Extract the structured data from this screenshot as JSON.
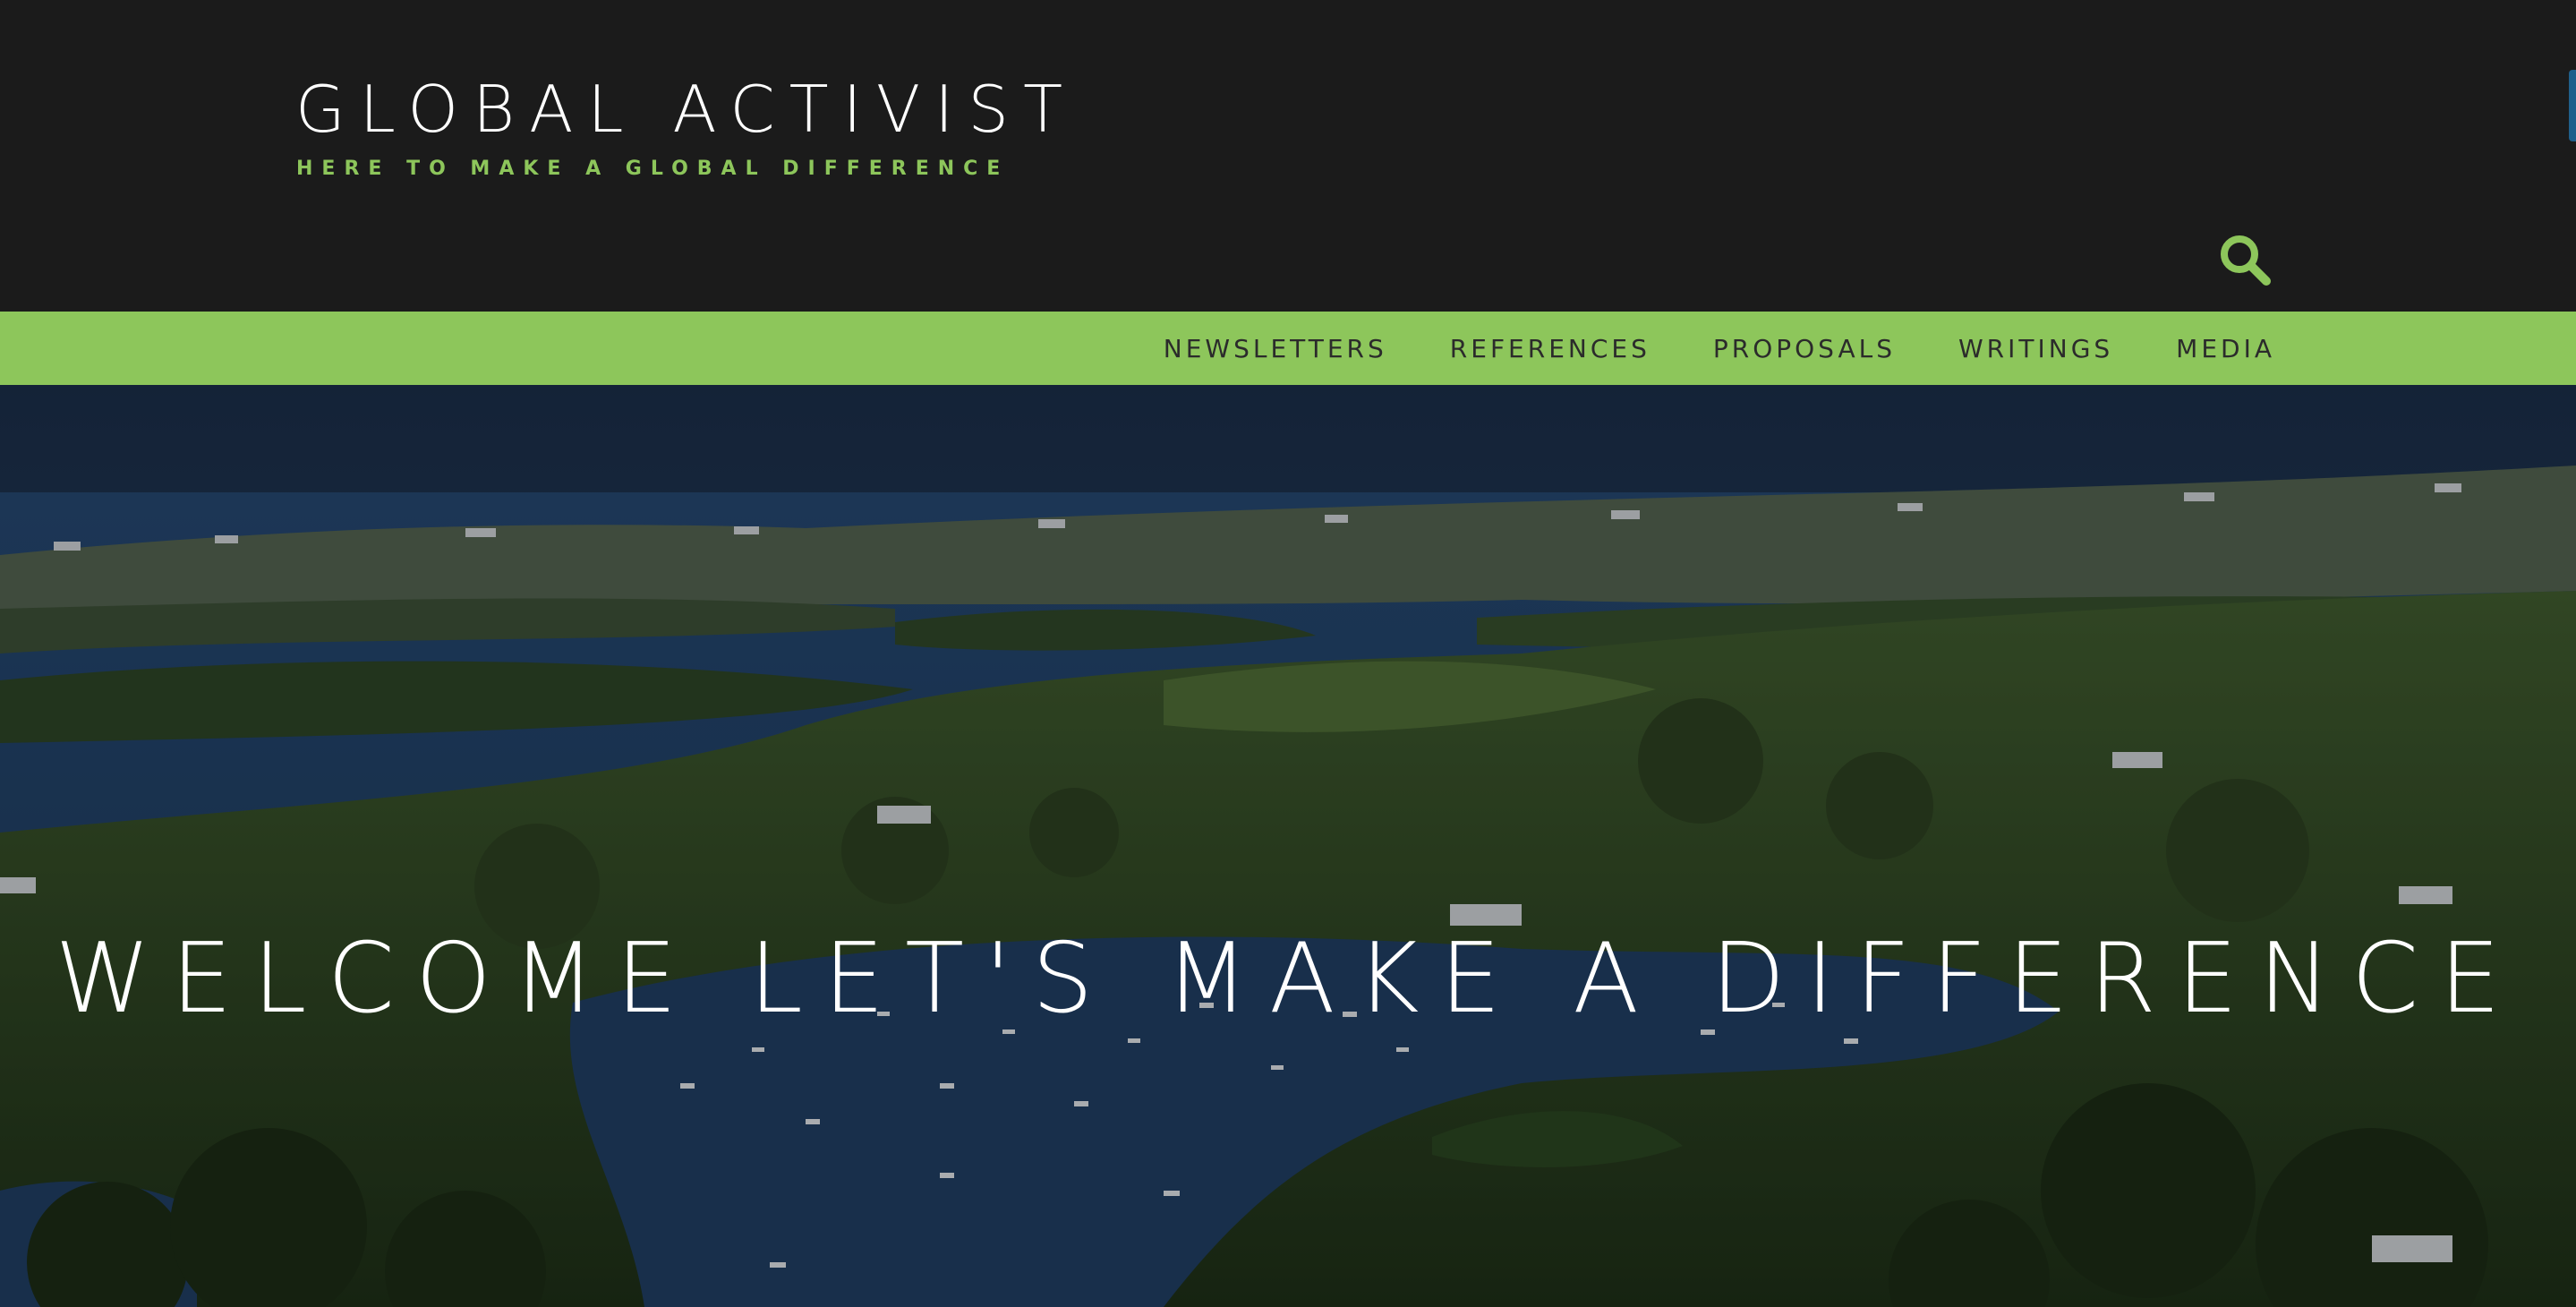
{
  "header": {
    "site_title": "GLOBAL ACTIVIST",
    "tagline": "HERE TO MAKE A GLOBAL DIFFERENCE",
    "search_icon": "search-icon"
  },
  "nav": {
    "items": [
      {
        "label": "NEWSLETTERS"
      },
      {
        "label": "REFERENCES"
      },
      {
        "label": "PROPOSALS"
      },
      {
        "label": "WRITINGS"
      },
      {
        "label": "MEDIA"
      }
    ]
  },
  "hero": {
    "heading": "WELCOME LET'S MAKE A DIFFERENCE"
  },
  "colors": {
    "header_background": "#1b1b1b",
    "accent_green": "#8dc65b",
    "nav_text": "#2b2b2b",
    "title_text": "#ffffff"
  }
}
